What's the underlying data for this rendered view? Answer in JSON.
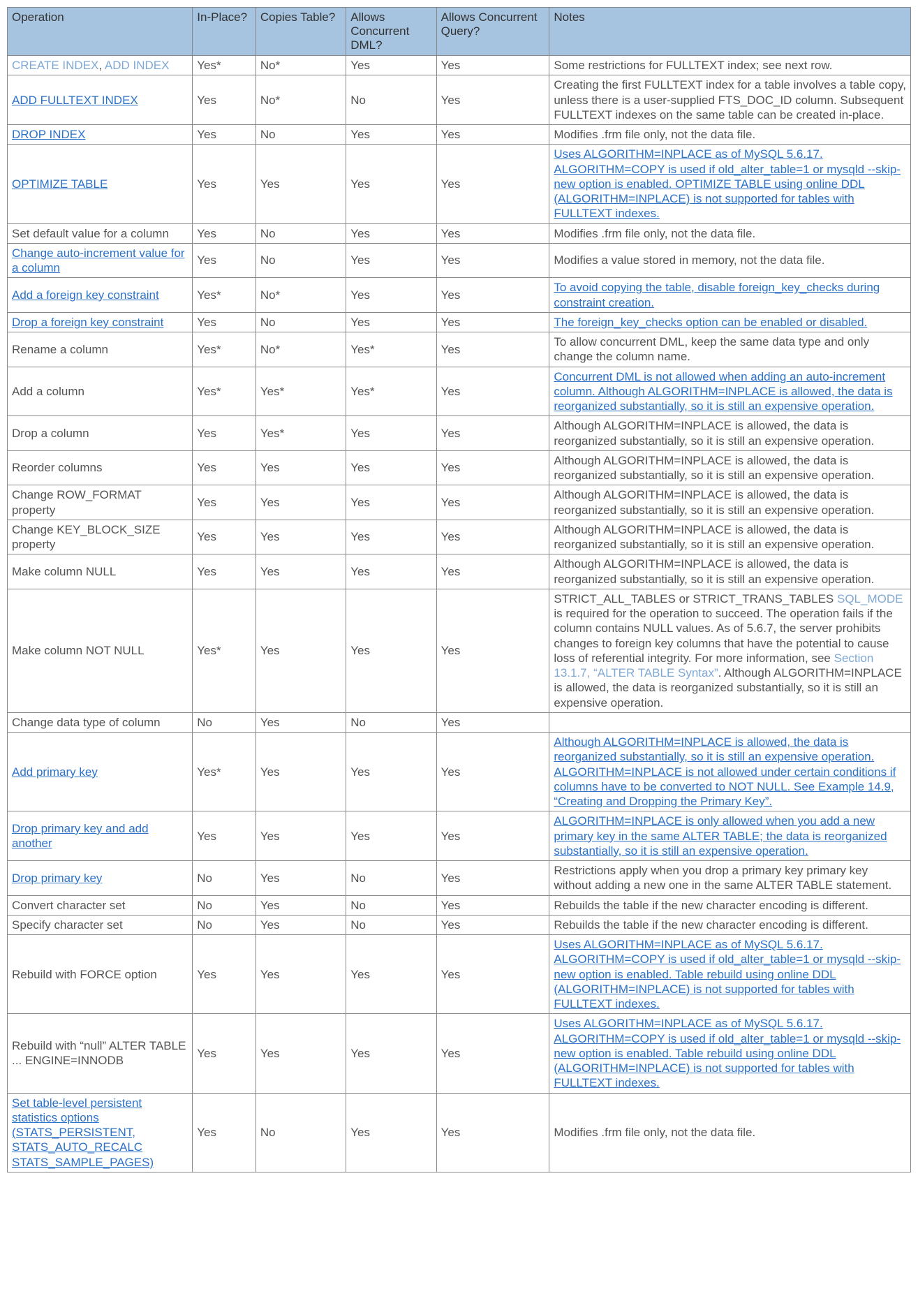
{
  "headers": [
    "Operation",
    "In-Place?",
    "Copies Table?",
    "Allows Concurrent DML?",
    "Allows Concurrent Query?",
    "Notes"
  ],
  "rows": [
    {
      "op": [
        {
          "t": "CREATE INDEX",
          "l": "faint"
        },
        {
          "t": ", ",
          "l": "plain"
        },
        {
          "t": "ADD INDEX",
          "l": "faint"
        }
      ],
      "v": [
        "Yes*",
        "No*",
        "Yes",
        "Yes"
      ],
      "notes": [
        {
          "t": "Some restrictions for FULLTEXT index; see next row.",
          "l": "plain"
        }
      ]
    },
    {
      "op": [
        {
          "t": "ADD FULLTEXT INDEX",
          "l": "link"
        }
      ],
      "v": [
        "Yes",
        "No*",
        "No",
        "Yes"
      ],
      "notes": [
        {
          "t": "Creating the first FULLTEXT index for a table involves a table copy, unless there is a user-supplied FTS_DOC_ID column. Subsequent FULLTEXT indexes on the same table can be created in-place.",
          "l": "plain"
        }
      ]
    },
    {
      "op": [
        {
          "t": "DROP INDEX",
          "l": "link"
        }
      ],
      "v": [
        "Yes",
        "No",
        "Yes",
        "Yes"
      ],
      "notes": [
        {
          "t": "Modifies .frm file only, not the data file.",
          "l": "plain"
        }
      ]
    },
    {
      "op": [
        {
          "t": "OPTIMIZE TABLE",
          "l": "link"
        }
      ],
      "v": [
        "Yes",
        "Yes",
        "Yes",
        "Yes"
      ],
      "notes": [
        {
          "t": "Uses ALGORITHM=INPLACE as of MySQL 5.6.17. ALGORITHM=COPY is used if old_alter_table=1 or mysqld --skip-new option is enabled. OPTIMIZE TABLE using online DDL (ALGORITHM=INPLACE) is not supported for tables with FULLTEXT indexes.",
          "l": "link"
        }
      ]
    },
    {
      "op": [
        {
          "t": "Set default value for a column",
          "l": "plain"
        }
      ],
      "v": [
        "Yes",
        "No",
        "Yes",
        "Yes"
      ],
      "notes": [
        {
          "t": "Modifies .frm file only, not the data file.",
          "l": "plain"
        }
      ]
    },
    {
      "op": [
        {
          "t": "Change auto-increment value for a column",
          "l": "link"
        }
      ],
      "v": [
        "Yes",
        "No",
        "Yes",
        "Yes"
      ],
      "notes": [
        {
          "t": "Modifies a value stored in memory, not the data file.",
          "l": "plain"
        }
      ]
    },
    {
      "op": [
        {
          "t": "Add a foreign key constraint",
          "l": "link"
        }
      ],
      "v": [
        "Yes*",
        "No*",
        "Yes",
        "Yes"
      ],
      "notes": [
        {
          "t": "To avoid copying the table, disable foreign_key_checks during constraint creation.",
          "l": "link"
        }
      ]
    },
    {
      "op": [
        {
          "t": "Drop a foreign key constraint",
          "l": "link"
        }
      ],
      "v": [
        "Yes",
        "No",
        "Yes",
        "Yes"
      ],
      "notes": [
        {
          "t": "The foreign_key_checks option can be enabled or disabled.",
          "l": "link"
        }
      ]
    },
    {
      "op": [
        {
          "t": "Rename a column",
          "l": "plain"
        }
      ],
      "v": [
        "Yes*",
        "No*",
        "Yes*",
        "Yes"
      ],
      "notes": [
        {
          "t": "To allow concurrent DML, keep the same data type and only change the column name.",
          "l": "plain"
        }
      ]
    },
    {
      "op": [
        {
          "t": "Add a column",
          "l": "plain"
        }
      ],
      "v": [
        "Yes*",
        "Yes*",
        "Yes*",
        "Yes"
      ],
      "notes": [
        {
          "t": "Concurrent DML is not allowed when adding an auto-increment column. Although ALGORITHM=INPLACE is allowed, the data is reorganized substantially, so it is still an expensive operation.",
          "l": "link"
        }
      ]
    },
    {
      "op": [
        {
          "t": "Drop a column",
          "l": "plain"
        }
      ],
      "v": [
        "Yes",
        "Yes*",
        "Yes",
        "Yes"
      ],
      "notes": [
        {
          "t": "Although ALGORITHM=INPLACE is allowed, the data is reorganized substantially, so it is still an expensive operation.",
          "l": "plain"
        }
      ]
    },
    {
      "op": [
        {
          "t": "Reorder columns",
          "l": "plain"
        }
      ],
      "v": [
        "Yes",
        "Yes",
        "Yes",
        "Yes"
      ],
      "notes": [
        {
          "t": "Although ALGORITHM=INPLACE is allowed, the data is reorganized substantially, so it is still an expensive operation.",
          "l": "plain"
        }
      ]
    },
    {
      "op": [
        {
          "t": "Change ROW_FORMAT property",
          "l": "plain"
        }
      ],
      "v": [
        "Yes",
        "Yes",
        "Yes",
        "Yes"
      ],
      "notes": [
        {
          "t": "Although ALGORITHM=INPLACE is allowed, the data is reorganized substantially, so it is still an expensive operation.",
          "l": "plain"
        }
      ]
    },
    {
      "op": [
        {
          "t": "Change KEY_BLOCK_SIZE property",
          "l": "plain"
        }
      ],
      "v": [
        "Yes",
        "Yes",
        "Yes",
        "Yes"
      ],
      "notes": [
        {
          "t": "Although ALGORITHM=INPLACE is allowed, the data is reorganized substantially, so it is still an expensive operation.",
          "l": "plain"
        }
      ]
    },
    {
      "op": [
        {
          "t": "Make column NULL",
          "l": "plain"
        }
      ],
      "v": [
        "Yes",
        "Yes",
        "Yes",
        "Yes"
      ],
      "notes": [
        {
          "t": "Although ALGORITHM=INPLACE is allowed, the data is reorganized substantially, so it is still an expensive operation.",
          "l": "plain"
        }
      ]
    },
    {
      "op": [
        {
          "t": "Make column NOT NULL",
          "l": "plain"
        }
      ],
      "v": [
        "Yes*",
        "Yes",
        "Yes",
        "Yes"
      ],
      "notes": [
        {
          "t": "STRICT_ALL_TABLES or STRICT_TRANS_TABLES ",
          "l": "plain"
        },
        {
          "t": "SQL_MODE",
          "l": "faint"
        },
        {
          "t": " is required for the operation to succeed. The operation fails if the column contains NULL values. As of 5.6.7, the server prohibits changes to foreign key columns that have the potential to cause loss of referential integrity. For more information, see ",
          "l": "plain"
        },
        {
          "t": "Section 13.1.7, “ALTER TABLE Syntax”",
          "l": "faint"
        },
        {
          "t": ". Although ALGORITHM=INPLACE is allowed, the data is reorganized substantially, so it is still an expensive operation.",
          "l": "plain"
        }
      ]
    },
    {
      "op": [
        {
          "t": "Change data type of column",
          "l": "plain"
        }
      ],
      "v": [
        "No",
        "Yes",
        "No",
        "Yes"
      ],
      "notes": [
        {
          "t": "",
          "l": "plain"
        }
      ]
    },
    {
      "op": [
        {
          "t": "Add primary key",
          "l": "link"
        }
      ],
      "v": [
        "Yes*",
        "Yes",
        "Yes",
        "Yes"
      ],
      "notes": [
        {
          "t": "Although ALGORITHM=INPLACE is allowed, the data is reorganized substantially, so it is still an expensive operation. ALGORITHM=INPLACE is not allowed under certain conditions if columns have to be converted to NOT NULL. See Example 14.9, “Creating and Dropping the Primary Key”.",
          "l": "link"
        }
      ]
    },
    {
      "op": [
        {
          "t": "Drop primary key and add another",
          "l": "link"
        }
      ],
      "v": [
        "Yes",
        "Yes",
        "Yes",
        "Yes"
      ],
      "notes": [
        {
          "t": "ALGORITHM=INPLACE is only allowed when you add a new primary key in the same ALTER TABLE; the data is reorganized substantially, so it is still an expensive operation.",
          "l": "link"
        }
      ]
    },
    {
      "op": [
        {
          "t": "Drop primary key",
          "l": "link"
        }
      ],
      "v": [
        "No",
        "Yes",
        "No",
        "Yes"
      ],
      "notes": [
        {
          "t": "Restrictions apply when you drop a primary key primary key without adding a new one in the same  ALTER TABLE statement.",
          "l": "plain"
        }
      ]
    },
    {
      "op": [
        {
          "t": "Convert character set",
          "l": "plain"
        }
      ],
      "v": [
        "No",
        "Yes",
        "No",
        "Yes"
      ],
      "notes": [
        {
          "t": "Rebuilds the table if the new character encoding is different.",
          "l": "plain"
        }
      ]
    },
    {
      "op": [
        {
          "t": "Specify character set",
          "l": "plain"
        }
      ],
      "v": [
        "No",
        "Yes",
        "No",
        "Yes"
      ],
      "notes": [
        {
          "t": "Rebuilds the table if the new character encoding is different.",
          "l": "plain"
        }
      ]
    },
    {
      "op": [
        {
          "t": "Rebuild with FORCE option",
          "l": "plain"
        }
      ],
      "v": [
        "Yes",
        "Yes",
        "Yes",
        "Yes"
      ],
      "notes": [
        {
          "t": "Uses ALGORITHM=INPLACE as of MySQL 5.6.17. ALGORITHM=COPY is used if old_alter_table=1 or mysqld --skip-new option is enabled. Table rebuild using online DDL (ALGORITHM=INPLACE) is not supported for tables with FULLTEXT indexes.",
          "l": "link"
        }
      ]
    },
    {
      "op": [
        {
          "t": "Rebuild with “null” ALTER TABLE ... ENGINE=INNODB",
          "l": "plain"
        }
      ],
      "v": [
        "Yes",
        "Yes",
        "Yes",
        "Yes"
      ],
      "notes": [
        {
          "t": "Uses ALGORITHM=INPLACE as of MySQL 5.6.17. ALGORITHM=COPY is used if old_alter_table=1 or mysqld --skip-new option is enabled. Table rebuild using online DDL (ALGORITHM=INPLACE) is not supported for tables with FULLTEXT indexes.",
          "l": "link"
        }
      ]
    },
    {
      "op": [
        {
          "t": "Set table-level persistent statistics options (STATS_PERSISTENT, STATS_AUTO_RECALC STATS_SAMPLE_PAGES)",
          "l": "link"
        }
      ],
      "v": [
        "Yes",
        "No",
        "Yes",
        "Yes"
      ],
      "notes": [
        {
          "t": "Modifies .frm file only, not the data file.",
          "l": "plain"
        }
      ]
    }
  ]
}
